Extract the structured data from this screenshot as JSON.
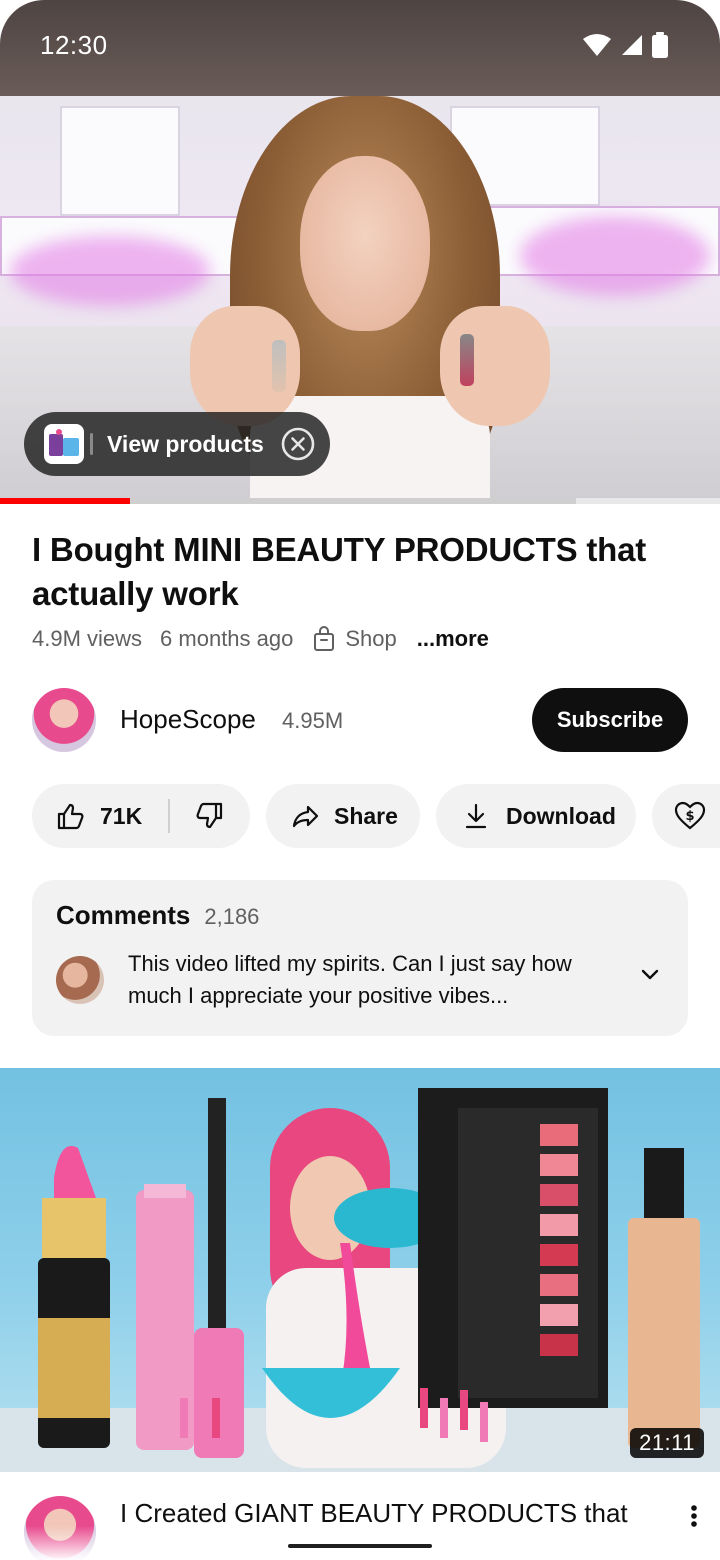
{
  "status_bar": {
    "time": "12:30"
  },
  "player": {
    "view_products_label": "View products",
    "progress_fraction": 0.18,
    "buffer_fraction": 0.8
  },
  "video": {
    "title": "I Bought MINI BEAUTY PRODUCTS that actually work",
    "views": "4.9M views",
    "age": "6 months ago",
    "shop_label": "Shop",
    "more_label": "...more"
  },
  "channel": {
    "name": "HopeScope",
    "subscribers": "4.95M",
    "subscribe_label": "Subscribe"
  },
  "actions": {
    "like_count": "71K",
    "share_label": "Share",
    "download_label": "Download"
  },
  "comments": {
    "label": "Comments",
    "count": "2,186",
    "top_comment": "This video lifted my spirits. Can I just say how much I appreciate your positive vibes..."
  },
  "next_video": {
    "duration": "21:11",
    "title": "I Created GIANT BEAUTY PRODUCTS that"
  },
  "colors": {
    "accent_red": "#ff0000",
    "subscribe_bg": "#0f0f0f",
    "chip_bg": "#f2f2f2"
  }
}
